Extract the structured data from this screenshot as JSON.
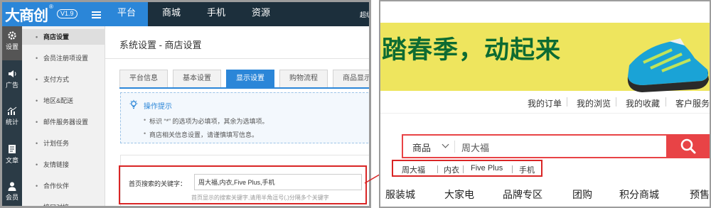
{
  "admin": {
    "logo": {
      "text": "大商创",
      "reg": "®",
      "version": "V1.9"
    },
    "topnav": {
      "tabs": [
        "平台",
        "商城",
        "手机",
        "资源"
      ],
      "active": 0,
      "overflow_text": "超级"
    },
    "iconbar": [
      {
        "label": "设置",
        "icon": "gear-icon",
        "active": true
      },
      {
        "label": "广告",
        "icon": "speaker-icon",
        "active": false
      },
      {
        "label": "统计",
        "icon": "chart-icon",
        "active": false
      },
      {
        "label": "文章",
        "icon": "document-icon",
        "active": false
      },
      {
        "label": "会员",
        "icon": "user-icon",
        "active": false
      }
    ],
    "submenu": [
      "商店设置",
      "会员注册项设置",
      "支付方式",
      "地区&配送",
      "邮件服务器设置",
      "计划任务",
      "友情链接",
      "合作伙伴",
      "接口对接"
    ],
    "submenu_active": 0,
    "page_title": "系统设置 - 商店设置",
    "tabs": [
      "平台信息",
      "基本设置",
      "显示设置",
      "购物流程",
      "商品显示"
    ],
    "tabs_active": 2,
    "tips": {
      "title": "操作提示",
      "lines": [
        "标识 “*” 的选项为必填项，其余为选填项。",
        "商店相关信息设置，请谨慎填写信息。"
      ]
    },
    "keyword_field": {
      "label": "首页搜索的关键字：",
      "value": "周大福,内衣,Five Plus,手机",
      "hint": "首页显示的搜索关键字,请用半角逗号(,)分隔多个关键字"
    }
  },
  "shop": {
    "banner_text": "踏春季，动起来",
    "quicklinks": [
      "我的订单",
      "我的浏览",
      "我的收藏",
      "客户服务"
    ],
    "search": {
      "category": "商品",
      "value": "周大福"
    },
    "hotwords": [
      "周大福",
      "内衣",
      "Five Plus",
      "手机"
    ],
    "nav": [
      "服装城",
      "大家电",
      "品牌专区",
      "团购",
      "积分商城",
      "预售"
    ]
  },
  "colors": {
    "accent_blue": "#2b86d8",
    "highlight_red": "#d92525",
    "search_red": "#e84346",
    "banner_yellow": "#eee55e",
    "banner_green": "#0d6b32"
  }
}
